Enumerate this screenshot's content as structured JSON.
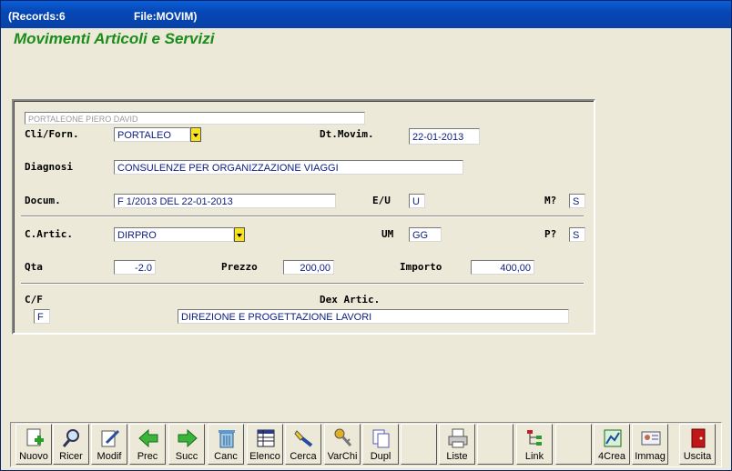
{
  "titlebar": {
    "records": "(Records:6",
    "file": "File:MOVIM)"
  },
  "app_title": "Movimenti Articoli e Servizi",
  "form": {
    "name_readonly": "PORTALEONE PIERO DAVID",
    "cli_label": "Cli/Forn.",
    "cli_value": "PORTALEO",
    "dt_label": "Dt.Movim.",
    "dt_value": "22-01-2013",
    "diagnosi_label": "Diagnosi",
    "diagnosi_value": "CONSULENZE PER ORGANIZZAZIONE VIAGGI",
    "docum_label": "Docum.",
    "docum_value": "F 1/2013 DEL 22-01-2013",
    "eu_label": "E/U",
    "eu_value": "U",
    "m_label": "M?",
    "m_value": "S",
    "artic_label": "C.Artic.",
    "artic_value": "DIRPRO",
    "um_label": "UM",
    "um_value": "GG",
    "p_label": "P?",
    "p_value": "S",
    "qta_label": "Qta",
    "qta_value": "-2.0",
    "prezzo_label": "Prezzo",
    "prezzo_value": "200,00",
    "importo_label": "Importo",
    "importo_value": "400,00",
    "cf_label": "C/F",
    "cf_value": "F",
    "dex_label": "Dex Artic.",
    "dex_value": "DIREZIONE E PROGETTAZIONE LAVORI"
  },
  "toolbar": {
    "nuovo": "Nuovo",
    "ricer": "Ricer",
    "modif": "Modif",
    "prec": "Prec",
    "succ": "Succ",
    "canc": "Canc",
    "elenco": "Elenco",
    "cerca": "Cerca",
    "varchi": "VarChi",
    "dupl": "Dupl",
    "liste": "Liste",
    "link": "Link",
    "crea4": "4Crea",
    "immag": "Immag",
    "uscita": "Uscita"
  }
}
